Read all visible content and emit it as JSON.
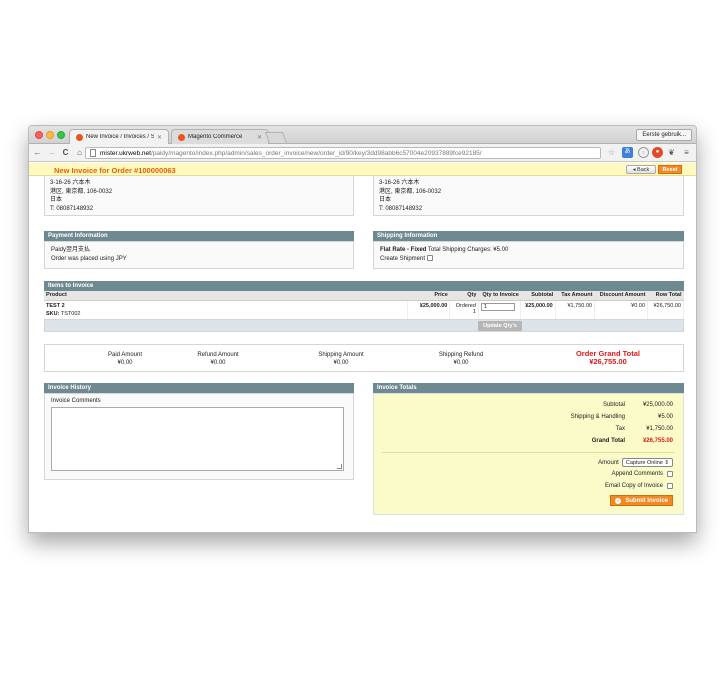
{
  "browser": {
    "tabs": [
      {
        "title": "New Invoice / Invoices / Sa",
        "active": true
      },
      {
        "title": "Magento Commerce",
        "active": false
      }
    ],
    "profile_label": "Eerste gebruik...",
    "url_host": "mister.ukrweb.net",
    "url_path": "/paidy/magento/index.php/admin/sales_order_invoice/new/order_id/90/key/3dd98abb6c57004e20937889fce92185/"
  },
  "header": {
    "title": "New Invoice for Order #100000063",
    "back_label": "Back",
    "reset_label": "Reset"
  },
  "billing_address": {
    "line1": "3-16-26 六本木",
    "line2": "港区, 東京都, 106-0032",
    "line3": "日本",
    "line4": "T: 08087148932"
  },
  "shipping_address": {
    "line1": "3-16-26 六本木",
    "line2": "港区, 東京都, 106-0032",
    "line3": "日本",
    "line4": "T: 08087148932"
  },
  "payment": {
    "heading": "Payment Information",
    "method": "Paidy翌月支払",
    "currency_note": "Order was placed using JPY"
  },
  "shipping": {
    "heading": "Shipping Information",
    "method_bold": "Flat Rate - Fixed",
    "charges": "Total Shipping Charges: ¥5.00",
    "create_shipment_label": "Create Shipment"
  },
  "items": {
    "heading": "Items to Invoice",
    "columns": [
      "Product",
      "Price",
      "Qty",
      "Qty to Invoice",
      "Subtotal",
      "Tax Amount",
      "Discount Amount",
      "Row Total"
    ],
    "rows": [
      {
        "name": "TEST 2",
        "sku_label": "SKU:",
        "sku": "TST002",
        "price": "¥25,000.00",
        "qty_status": "Ordered",
        "qty": "1",
        "qty_to_invoice": "1",
        "subtotal": "¥25,000.00",
        "tax": "¥1,750.00",
        "discount": "¥0.00",
        "row_total": "¥26,750.00"
      }
    ],
    "update_label": "Update Qty's"
  },
  "summary": {
    "paid_label": "Paid Amount",
    "paid_value": "¥0.00",
    "refund_label": "Refund Amount",
    "refund_value": "¥0.00",
    "shipping_label": "Shipping Amount",
    "shipping_value": "¥0.00",
    "shipping_refund_label": "Shipping Refund",
    "shipping_refund_value": "¥0.00",
    "grand_label": "Order Grand Total",
    "grand_value": "¥26,755.00"
  },
  "history": {
    "heading": "Invoice History",
    "comments_label": "Invoice Comments",
    "comments_value": ""
  },
  "totals": {
    "heading": "Invoice Totals",
    "subtotal_label": "Subtotal",
    "subtotal_value": "¥25,000.00",
    "shipping_label": "Shipping & Handling",
    "shipping_value": "¥5.00",
    "tax_label": "Tax",
    "tax_value": "¥1,750.00",
    "grand_label": "Grand Total",
    "grand_value": "¥26,755.00",
    "amount_label": "Amount",
    "capture_option": "Capture Online",
    "append_label": "Append Comments",
    "email_label": "Email Copy of Invoice",
    "submit_label": "Submit Invoice"
  },
  "colors": {
    "accent": "#eb5e00",
    "header_bg": "#fefabf",
    "section_head": "#6f8992",
    "totals_bg": "#fbfbc9",
    "grand_total": "#e01a1a",
    "button_orange": "#f18a22"
  }
}
